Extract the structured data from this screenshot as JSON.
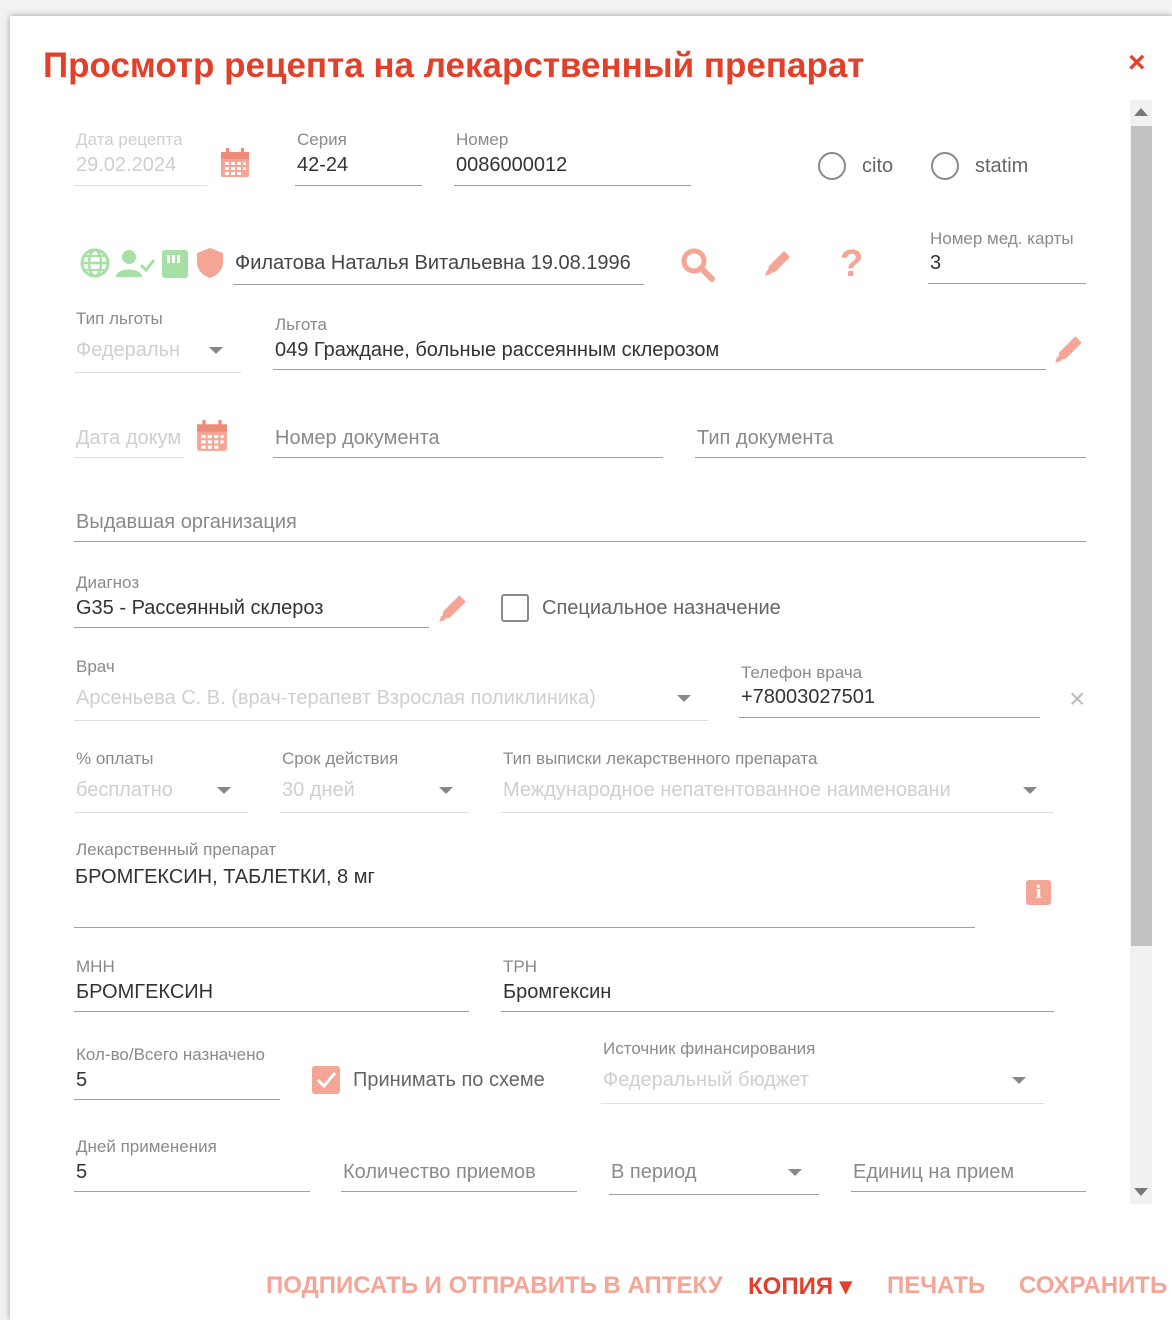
{
  "title": "Просмотр рецепта на лекарственный препарат",
  "close_icon": "×",
  "colors": {
    "accent": "#e2402a",
    "accent_light": "#f4a596",
    "disabled": "#cfcfcf"
  },
  "recipe": {
    "date_label": "Дата рецепта",
    "date_value": "29.02.2024",
    "series_label": "Серия",
    "series_value": "42-24",
    "number_label": "Номер",
    "number_value": "0086000012",
    "cito": "cito",
    "statim": "statim"
  },
  "patient": {
    "name": "Филатова Наталья Витальевна 19.08.1996",
    "icons": [
      "globe-icon",
      "user-check-icon",
      "card-icon",
      "shield-icon"
    ],
    "help_icon": "?",
    "card_label": "Номер мед. карты",
    "card_value": "3"
  },
  "privilege": {
    "type_label": "Тип льготы",
    "type_value": "Федеральн",
    "label": "Льгота",
    "value": "049 Граждане, больные рассеянным склерозом"
  },
  "document": {
    "date_placeholder": "Дата докум",
    "number_placeholder": "Номер документа",
    "type_placeholder": "Тип документа",
    "org_placeholder": "Выдавшая организация"
  },
  "diagnosis": {
    "label": "Диагноз",
    "value": "G35 - Рассеянный склероз",
    "special_label": "Специальное назначение"
  },
  "doctor": {
    "label": "Врач",
    "value": "Арсеньева С. В. (врач-терапевт Взрослая поликлиника)",
    "phone_label": "Телефон врача",
    "phone_value": "+78003027501",
    "clear_icon": "×"
  },
  "payment": {
    "label": "% оплаты",
    "value": "бесплатно",
    "validity_label": "Срок действия",
    "validity_value": "30 дней",
    "issue_type_label": "Тип выписки лекарственного препарата",
    "issue_type_value": "Международное непатентованное наименовани"
  },
  "drug": {
    "label": "Лекарственный препарат",
    "value": "БРОМГЕКСИН, ТАБЛЕТКИ, 8 мг",
    "info_icon": "i",
    "mnn_label": "МНН",
    "mnn_value": "БРОМГЕКСИН",
    "trn_label": "ТРН",
    "trn_value": "Бромгексин"
  },
  "dosing": {
    "qty_label": "Кол-во/Всего назначено",
    "qty_value": "5",
    "scheme_label": "Принимать по схеме",
    "scheme_checked": true,
    "finance_label": "Источник финансирования",
    "finance_value": "Федеральный бюджет",
    "days_label": "Дней применения",
    "days_value": "5",
    "intakes_placeholder": "Количество приемов",
    "period_placeholder": "В период",
    "units_placeholder": "Единиц на прием"
  },
  "actions": {
    "sign_send": "ПОДПИСАТЬ И ОТПРАВИТЬ В АПТЕКУ",
    "copy": "КОПИЯ ▾",
    "print": "ПЕЧАТЬ",
    "save": "СОХРАНИТЬ"
  }
}
